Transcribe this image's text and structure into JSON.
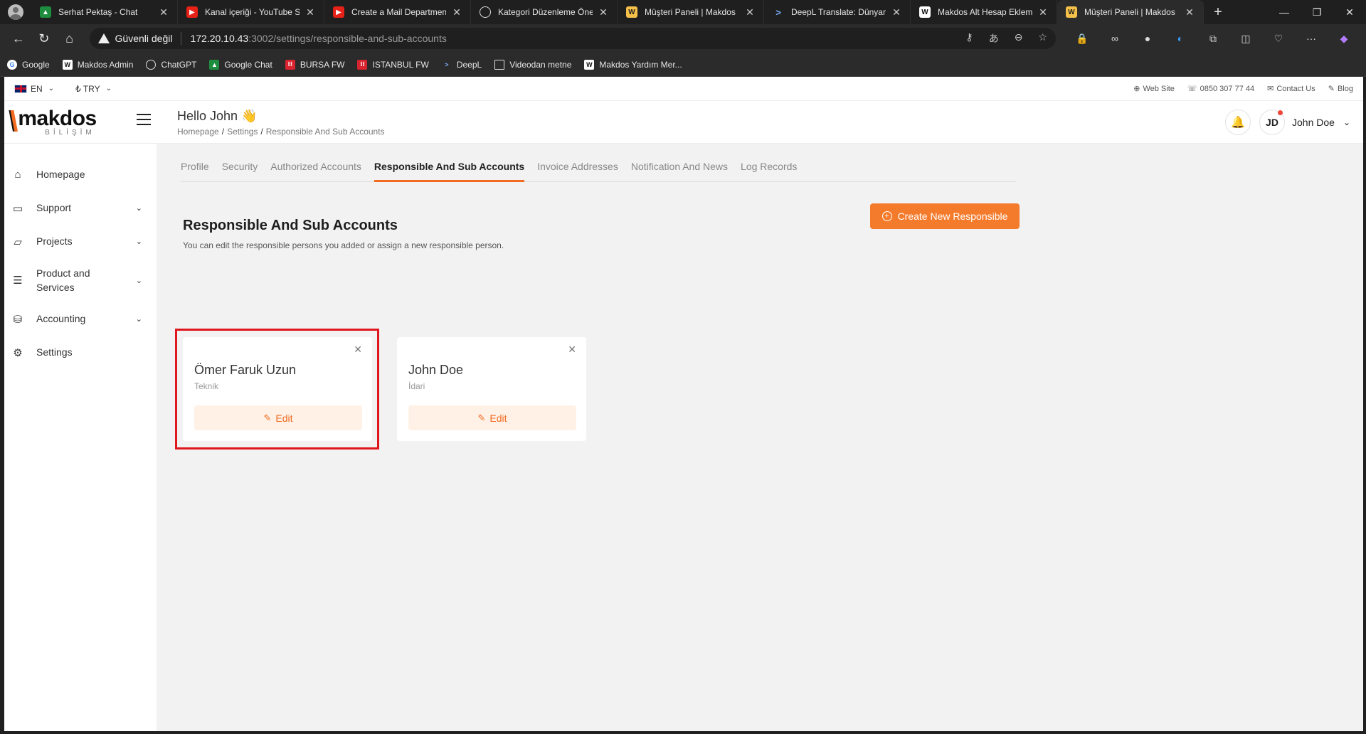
{
  "browser": {
    "tabs": [
      {
        "title": "Serhat Pektaş - Chat",
        "favicon": "chat-icon",
        "active": false
      },
      {
        "title": "Kanal içeriği - YouTube Stud",
        "favicon": "youtube-icon",
        "active": false
      },
      {
        "title": "Create a Mail Department -",
        "favicon": "youtube-icon",
        "active": false
      },
      {
        "title": "Kategori Düzenleme Önerisi",
        "favicon": "chatgpt-icon",
        "active": false
      },
      {
        "title": "Müşteri Paneli | Makdos",
        "favicon": "makdos-icon",
        "active": false
      },
      {
        "title": "DeepL Translate: Dünyanın e",
        "favicon": "deepl-icon",
        "active": false
      },
      {
        "title": "Makdos Alt Hesap Ekleme |",
        "favicon": "makdos-w-icon",
        "active": false
      },
      {
        "title": "Müşteri Paneli | Makdos",
        "favicon": "makdos-icon",
        "active": true
      }
    ],
    "address": {
      "security_label": "Güvenli değil",
      "host": "172.20.10.43",
      "path": ":3002/settings/responsible-and-sub-accounts"
    },
    "bookmarks": [
      {
        "label": "Google",
        "icon": "google-icon"
      },
      {
        "label": "Makdos Admin",
        "icon": "makdos-w-icon"
      },
      {
        "label": "ChatGPT",
        "icon": "chatgpt-icon"
      },
      {
        "label": "Google Chat",
        "icon": "chat-icon"
      },
      {
        "label": "BURSA FW",
        "icon": "firewall-icon"
      },
      {
        "label": "ISTANBUL FW",
        "icon": "firewall-icon"
      },
      {
        "label": "DeepL",
        "icon": "deepl-icon"
      },
      {
        "label": "Videodan metne",
        "icon": "folder-icon"
      },
      {
        "label": "Makdos Yardım Mer...",
        "icon": "makdos-w-icon"
      }
    ]
  },
  "topbar": {
    "language": "EN",
    "currency": "₺ TRY",
    "links": {
      "website": "Web Site",
      "phone": "0850 307 77 44",
      "contact": "Contact Us",
      "blog": "Blog"
    }
  },
  "header": {
    "logo_word": "makdos",
    "logo_sub": "BİLİŞİM",
    "greeting": "Hello John 👋",
    "breadcrumb": [
      "Homepage",
      "Settings",
      "Responsible And Sub Accounts"
    ],
    "user_initials": "JD",
    "user_name": "John Doe"
  },
  "sidebar": {
    "items": [
      {
        "label": "Homepage",
        "icon": "home-icon",
        "has_children": false
      },
      {
        "label": "Support",
        "icon": "support-icon",
        "has_children": true
      },
      {
        "label": "Projects",
        "icon": "folder-icon",
        "has_children": true
      },
      {
        "label": "Product and Services",
        "icon": "list-icon",
        "has_children": true
      },
      {
        "label": "Accounting",
        "icon": "coins-icon",
        "has_children": true
      },
      {
        "label": "Settings",
        "icon": "gear-icon",
        "has_children": false
      }
    ]
  },
  "settings_tabs": [
    {
      "label": "Profile",
      "active": false
    },
    {
      "label": "Security",
      "active": false
    },
    {
      "label": "Authorized Accounts",
      "active": false
    },
    {
      "label": "Responsible And Sub Accounts",
      "active": true
    },
    {
      "label": "Invoice Addresses",
      "active": false
    },
    {
      "label": "Notification And News",
      "active": false
    },
    {
      "label": "Log Records",
      "active": false
    }
  ],
  "section": {
    "title": "Responsible And Sub Accounts",
    "subtitle": "You can edit the responsible persons you added or assign a new responsible person.",
    "create_button": "Create New Responsible"
  },
  "cards": [
    {
      "name": "Ömer Faruk Uzun",
      "role": "Teknik",
      "edit_label": "Edit",
      "highlighted": true
    },
    {
      "name": "John Doe",
      "role": "İdari",
      "edit_label": "Edit",
      "highlighted": false
    }
  ],
  "colors": {
    "accent": "#f26b21",
    "button": "#f47b2c",
    "highlight": "#e0161e"
  }
}
